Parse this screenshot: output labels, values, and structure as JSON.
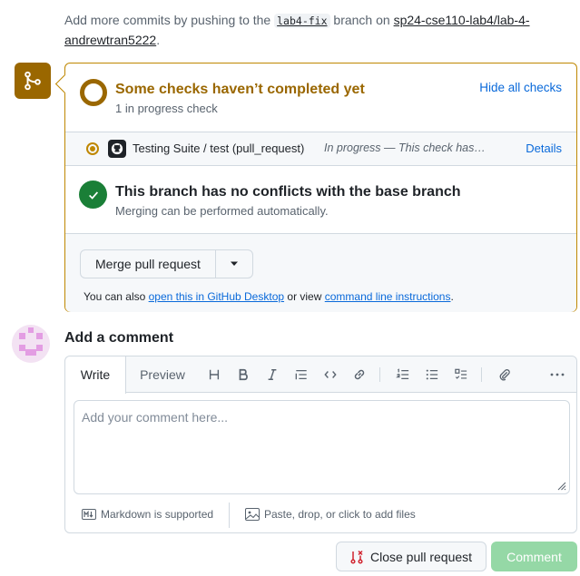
{
  "top_note": {
    "prefix": "Add more commits by pushing to the",
    "branch": "lab4-fix",
    "middle": "branch on",
    "repo": "sp24-cse110-lab4/lab-4-andrewtran5222",
    "suffix": "."
  },
  "checks": {
    "title": "Some checks haven’t completed yet",
    "subtitle": "1 in progress check",
    "hide_label": "Hide all checks",
    "items": [
      {
        "name": "Testing Suite / test (pull_request)",
        "status": "In progress — This check has…",
        "details_label": "Details"
      }
    ]
  },
  "conflicts": {
    "title": "This branch has no conflicts with the base branch",
    "subtitle": "Merging can be performed automatically."
  },
  "merge": {
    "button_label": "Merge pull request",
    "also_prefix": "You can also",
    "desktop_link": "open this in GitHub Desktop",
    "or_view": "or view",
    "cli_link": "command line instructions",
    "suffix": "."
  },
  "comment": {
    "heading": "Add a comment",
    "tabs": [
      "Write",
      "Preview"
    ],
    "toolbar_icons": [
      "heading-icon",
      "bold-icon",
      "italic-icon",
      "quote-icon",
      "code-icon",
      "link-icon",
      "ordered-list-icon",
      "unordered-list-icon",
      "task-list-icon",
      "attach-icon",
      "more-icon"
    ],
    "placeholder": "Add your comment here...",
    "markdown_note": "Markdown is supported",
    "attach_note": "Paste, drop, or click to add files"
  },
  "actions": {
    "close_label": "Close pull request",
    "comment_label": "Comment"
  },
  "colors": {
    "pending": "#9a6700",
    "success": "#1a7f37",
    "link": "#0969da",
    "comment_disabled": "#95d8a6"
  }
}
